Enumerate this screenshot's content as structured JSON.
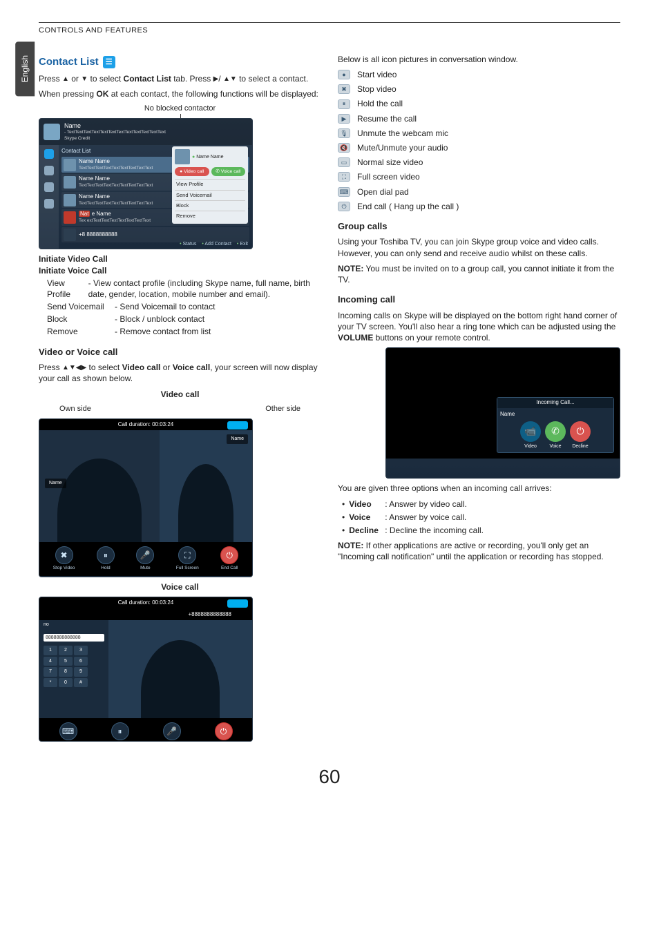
{
  "header": {
    "running": "CONTROLS AND FEATURES",
    "language_tab": "English"
  },
  "page_number": "60",
  "left": {
    "h_contact_list": "Contact List",
    "p_select": [
      "Press ",
      " or ",
      " to select ",
      "Contact List",
      " tab. Press ",
      "/ ",
      " to select a contact."
    ],
    "p_ok": [
      "When pressing ",
      "OK",
      " at each contact, the following functions will be displayed:"
    ],
    "callout_noblock": "No blocked contactor",
    "contact_shot": {
      "top_name": "Name",
      "top_sub": "- TextTextTextTextTextTextTextTextTextTextTextText",
      "top_credit": "Skype Credit",
      "list_title": "Contact List",
      "rows": [
        {
          "name": "Name Name",
          "sub": "TextTextTextTextTextTextTextTextText"
        },
        {
          "name": "Name Name",
          "sub": "TextTextTextTextTextTextTextTextText"
        },
        {
          "name": "Name Name",
          "sub": "TextTextTextTextTextTextTextTextText"
        },
        {
          "name": "e Name",
          "sub": "extTextTextTextTextTextTextText",
          "badge": "Nat"
        },
        {
          "name": "+8  8888888888",
          "sub": ""
        }
      ],
      "flyout": {
        "head_name": "Name Name",
        "btn_video": "Video call",
        "btn_voice": "Voice call",
        "items": [
          "View Profile",
          "Send Voicemail",
          "Block",
          "Remove"
        ]
      },
      "footer": [
        "Status",
        "Add Contact",
        "Exit"
      ]
    },
    "initiate_video": "Initiate Video Call",
    "initiate_voice": "Initiate Voice Call",
    "funcs": [
      {
        "t": "View Profile",
        "d": "- View contact profile (including Skype name, full name, birth date, gender, location, mobile number and email)."
      },
      {
        "t": "Send Voicemail",
        "d": "- Send Voicemail to contact"
      },
      {
        "t": "Block",
        "d": "- Block / unblock contact"
      },
      {
        "t": "Remove",
        "d": "- Remove contact from list"
      }
    ],
    "h_video_voice": "Video or Voice call",
    "p_vv": [
      "Press ",
      " to select ",
      "Video call",
      " or ",
      "Voice call",
      ", your screen will now display your call as shown below."
    ],
    "cap_video": "Video call",
    "lbl_own": "Own side",
    "lbl_other": "Other side",
    "video_shot": {
      "duration": "Call duration: 00:03:24",
      "name": "Name",
      "ctrls": [
        "Stop Video",
        "Hold",
        "Mute",
        "Full Screen",
        "End Call"
      ]
    },
    "cap_voice": "Voice call",
    "voice_shot": {
      "duration": "Call duration: 00:03:24",
      "number": "+8888888888888",
      "own_num": "8888888888888",
      "keys": [
        "1",
        "2",
        "3",
        "4",
        "5",
        "6",
        "7",
        "8",
        "9",
        "*",
        "0",
        "#"
      ],
      "ctrls": [
        "Dial Pad",
        "Hold",
        "Mute",
        "End Call"
      ]
    }
  },
  "right": {
    "p_intro": "Below is all icon pictures in conversation window.",
    "icons": [
      "Start video",
      "Stop video",
      "Hold the call",
      "Resume the call",
      "Unmute the webcam mic",
      "Mute/Unmute your audio",
      "Normal size video",
      "Full screen video",
      "Open dial pad",
      "End call ( Hang up the call )"
    ],
    "h_group": "Group calls",
    "p_group": "Using your Toshiba TV, you can join Skype group voice and video calls. However, you can only send and receive audio whilst on these calls.",
    "note_group": [
      "NOTE:",
      " You must be invited on to a group call, you cannot initiate it from the TV."
    ],
    "h_incoming": "Incoming call",
    "p_incoming": [
      "Incoming calls on Skype will be displayed on the bottom right hand corner of your TV screen. You'll also hear a ring tone which can be adjusted using the ",
      "VOLUME",
      " buttons on your remote control."
    ],
    "ic_shot": {
      "title": "Incoming Call...",
      "name": "Name",
      "btns": [
        "Video",
        "Voice",
        "Decline"
      ]
    },
    "p_options": "You are given three options when an incoming call arrives:",
    "options": [
      {
        "t": "Video",
        "d": ": Answer by video call."
      },
      {
        "t": "Voice",
        "d": ": Answer by voice call."
      },
      {
        "t": "Decline",
        "d": ": Decline the incoming call."
      }
    ],
    "note_inc": [
      "NOTE:",
      " If other applications are active or recording, you'll only get an \"Incoming call notification\" until the application or recording has stopped."
    ]
  }
}
